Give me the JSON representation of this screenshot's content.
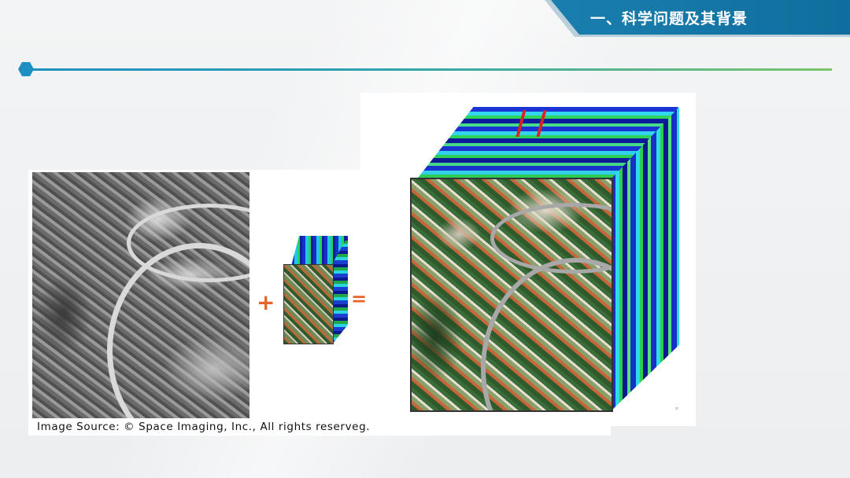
{
  "header": {
    "title": "一、科学问题及其背景",
    "banner_color": "#1a7fae",
    "divider_colors": [
      "#1f8fc0",
      "#7bc46a"
    ]
  },
  "figure": {
    "panchromatic_image": "grayscale-aerial-image",
    "small_cube_image": "hyperspectral-cube-small",
    "large_cube_image": "hyperspectral-cube-large",
    "operators": {
      "plus": "+",
      "equals": "="
    },
    "operator_color": "#e8632a",
    "caption": "Image Source: © Space Imaging, Inc., All rights reserveg."
  }
}
